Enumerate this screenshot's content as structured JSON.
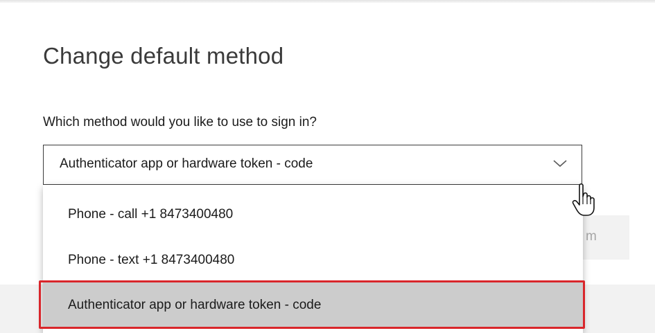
{
  "dialog": {
    "title": "Change default method",
    "question": "Which method would you like to use to sign in?"
  },
  "select": {
    "value": "Authenticator app or hardware token - code",
    "icon": "chevron-down-icon",
    "options": [
      {
        "label": "Phone - call +1 8473400480",
        "selected": false
      },
      {
        "label": "Phone - text +1 8473400480",
        "selected": false
      },
      {
        "label": "Authenticator app or hardware token - code",
        "selected": true
      }
    ]
  },
  "partially_hidden_button": {
    "visible_text": "m"
  },
  "annotation": {
    "highlight_color": "#d9262b"
  },
  "cursor": {
    "icon": "hand-pointer-icon"
  }
}
